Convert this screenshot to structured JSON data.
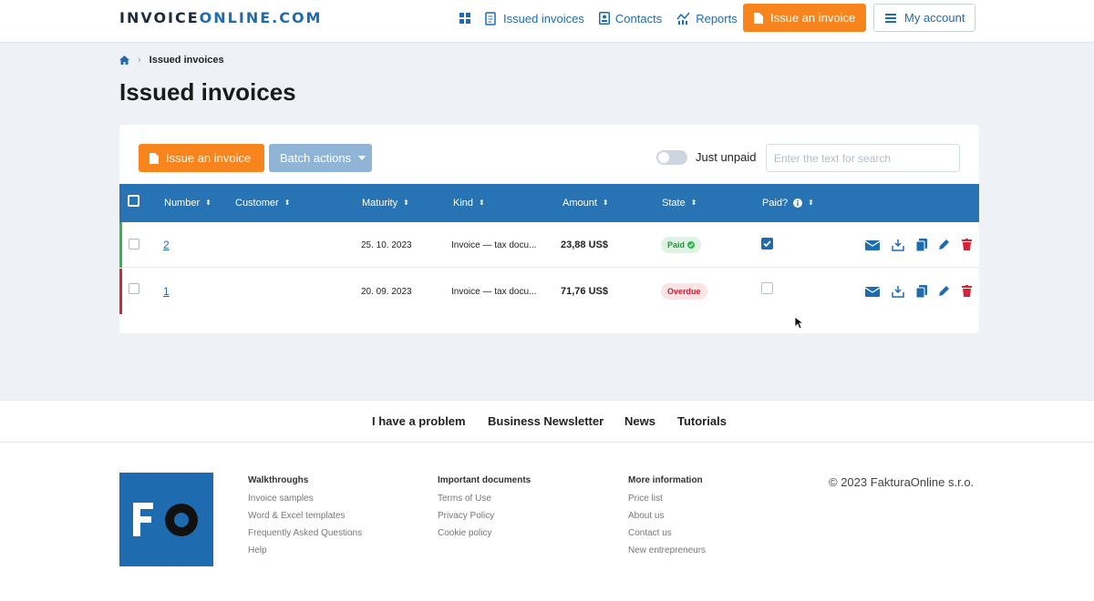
{
  "header": {
    "logo_part1": "INVOICE",
    "logo_part2": "ONLINE.COM",
    "nav": [
      {
        "label": "Issued invoices",
        "icon": "document-list-icon"
      },
      {
        "label": "Contacts",
        "icon": "contact-card-icon"
      },
      {
        "label": "Reports",
        "icon": "chart-icon"
      }
    ],
    "issue_button": "Issue an invoice",
    "account_button": "My account"
  },
  "breadcrumb": {
    "current": "Issued invoices"
  },
  "page_title": "Issued invoices",
  "toolbar": {
    "issue_button": "Issue an invoice",
    "batch_button": "Batch actions",
    "toggle_label": "Just unpaid",
    "toggle_on": false,
    "search_placeholder": "Enter the text for search"
  },
  "table": {
    "columns": [
      "Number",
      "Customer",
      "Maturity",
      "Kind",
      "Amount",
      "State",
      "Paid?"
    ],
    "rows": [
      {
        "number": "2",
        "customer": "",
        "maturity": "25. 10. 2023",
        "kind": "Invoice — tax docu...",
        "amount": "23,88 US$",
        "state": "Paid",
        "paid": true,
        "accent": "#2fb84a"
      },
      {
        "number": "1",
        "customer": "",
        "maturity": "20. 09. 2023",
        "kind": "Invoice — tax docu...",
        "amount": "71,76 US$",
        "state": "Overdue",
        "paid": false,
        "accent": "#d4243a"
      }
    ]
  },
  "bottom_nav": [
    "I have a problem",
    "Business Newsletter",
    "News",
    "Tutorials"
  ],
  "footer": {
    "logo_text": "FO",
    "columns": [
      {
        "title": "Walkthroughs",
        "links": [
          "Invoice samples",
          "Word & Excel templates",
          "Frequently Asked Questions",
          "Help"
        ]
      },
      {
        "title": "Important documents",
        "links": [
          "Terms of Use",
          "Privacy Policy",
          "Cookie policy"
        ]
      },
      {
        "title": "More information",
        "links": [
          "Price list",
          "About us",
          "Contact us",
          "New entrepreneurs"
        ]
      }
    ],
    "copyright": "© 2023 FakturaOnline s.r.o."
  },
  "colors": {
    "primary": "#2773b4",
    "accent_orange": "#f7841d",
    "paid_green": "#2fb84a",
    "overdue_red": "#d4243a"
  }
}
